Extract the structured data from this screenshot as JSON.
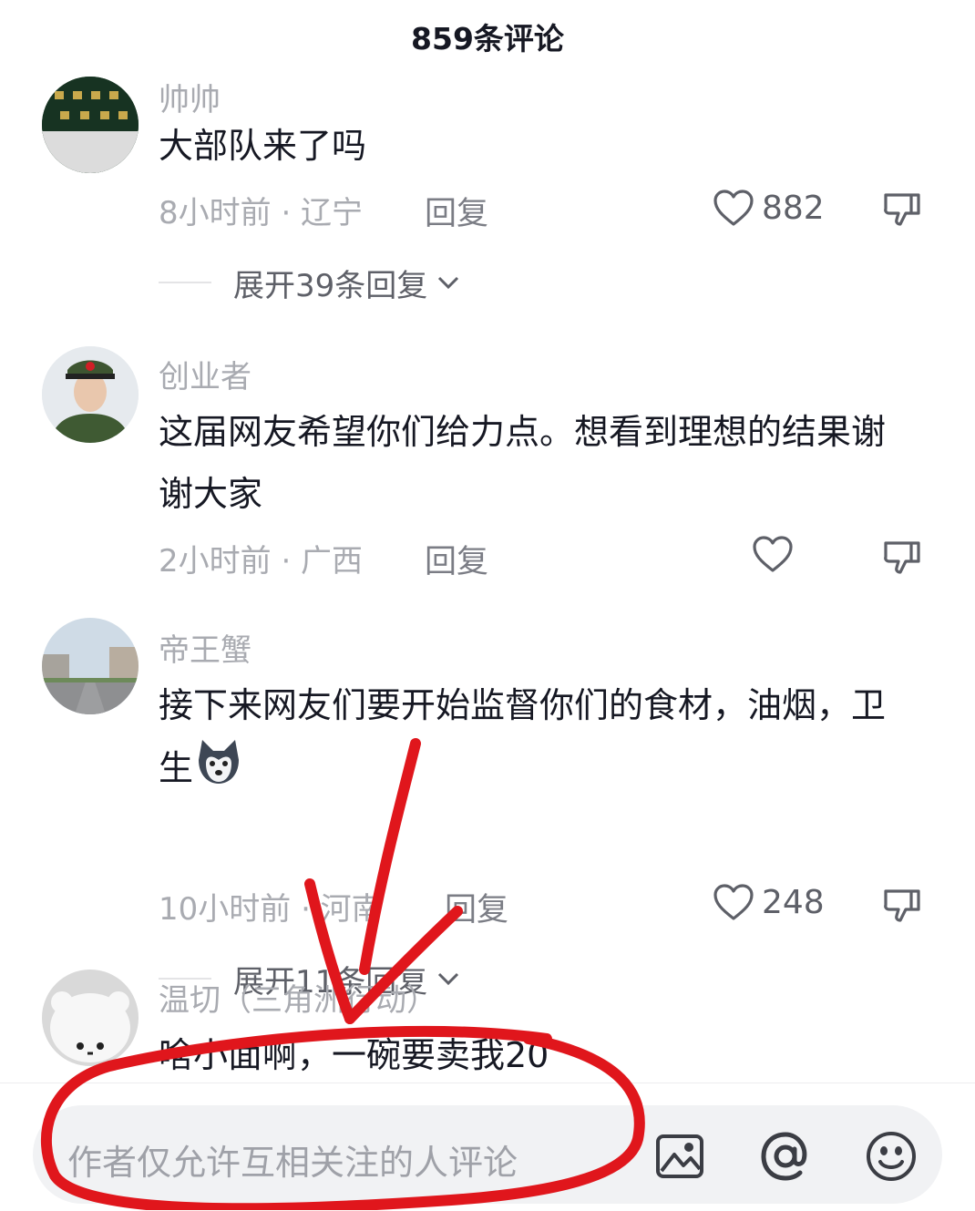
{
  "header": {
    "title": "859条评论"
  },
  "comments": [
    {
      "username": "帅帅",
      "text": "大部队来了吗",
      "time_location": "8小时前 · 辽宁",
      "reply_label": "回复",
      "likes": "882",
      "expand_label": "展开39条回复"
    },
    {
      "username": "创业者",
      "text": "这届网友希望你们给力点。想看到理想的结果谢谢大家",
      "time_location": "2小时前 · 广西",
      "reply_label": "回复",
      "likes": ""
    },
    {
      "username": "帝王蟹",
      "text": "接下来网友们要开始监督你们的食材，油烟，卫生",
      "time_location": "10小时前 · 河南",
      "reply_label": "回复",
      "likes": "248",
      "expand_label": "展开11条回复"
    },
    {
      "username": "温切（三角洲行动）",
      "text": "啥小面啊，一碗要卖我20"
    }
  ],
  "bottom_bar": {
    "placeholder": "作者仅允许互相关注的人评论",
    "icons": [
      "image-icon",
      "at-icon",
      "emoji-icon"
    ]
  },
  "colors": {
    "accent_red": "#e0161c",
    "secondary_text": "#a9abb1"
  }
}
